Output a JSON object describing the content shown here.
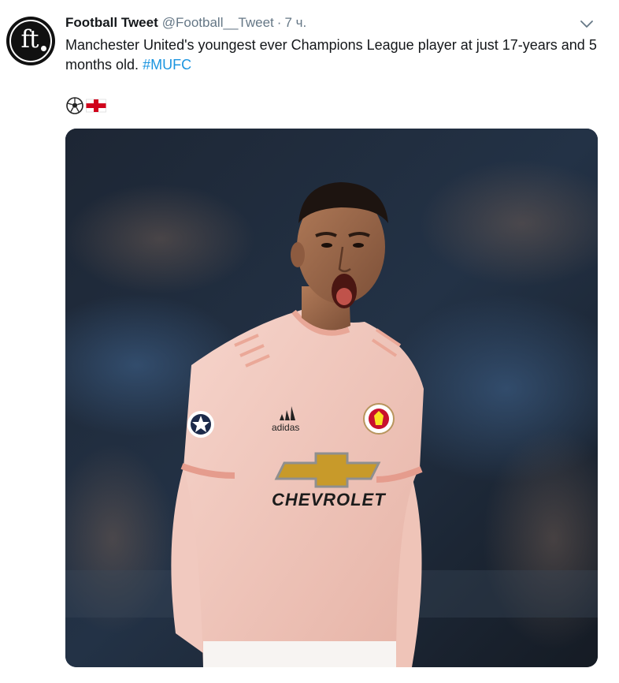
{
  "tweet": {
    "author_name": "Football Tweet",
    "author_handle": "@Football__Tweet",
    "separator": "·",
    "time": "7 ч.",
    "avatar_text": "ft",
    "text_main": "Manchester United's youngest ever Champions League player at just 17-years and 5 months old.",
    "hashtag": "#MUFC",
    "emojis": [
      "soccer-ball-emoji",
      "england-flag-emoji"
    ],
    "media": {
      "kit_sponsor": "CHEVROLET",
      "kit_brand": "adidas"
    }
  },
  "colors": {
    "link": "#1b95e0",
    "secondary_text": "#657786",
    "primary_text": "#14171a",
    "kit_pink": "#f2c7bd"
  }
}
